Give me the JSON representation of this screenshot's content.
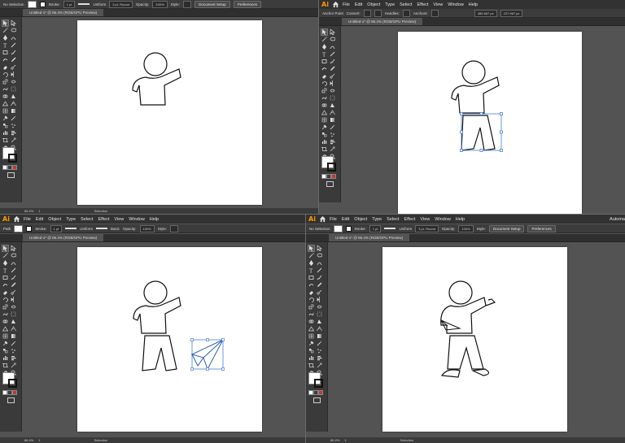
{
  "app": {
    "logo": "Ai"
  },
  "menu": [
    "File",
    "Edit",
    "Object",
    "Type",
    "Select",
    "Effect",
    "View",
    "Window",
    "Help"
  ],
  "right_edge_label": "Automa",
  "panes": [
    {
      "id": "tl",
      "control": {
        "selection_label": "No Selection",
        "stroke_label": "Stroke:",
        "stroke_weight": "1 pt",
        "profile_label": "Uniform",
        "brush_label": "3 pt. Round",
        "opacity_label": "Opacity:",
        "opacity_value": "100%",
        "style_label": "Style:",
        "doc_setup": "Document Setup",
        "preferences": "Preferences"
      },
      "tab_title": "Untitled-1* @ 86.4% (RGB/GPU Preview)",
      "status": {
        "zoom": "86.4%",
        "page": "1",
        "tool": "Selection"
      }
    },
    {
      "id": "tr",
      "control": {
        "selection_label": "Anchor Point",
        "convert_label": "Convert:",
        "handles_label": "Handles:",
        "anchors_label": "Anchors:",
        "x_value": "389.667 px",
        "y_value": "227.967 px"
      },
      "tab_title": "Untitled-1* @ 86.4% (RGB/GPU Preview)",
      "status": {
        "zoom": "",
        "page": "",
        "tool": ""
      }
    },
    {
      "id": "bl",
      "control": {
        "selection_label": "Path",
        "stroke_label": "Stroke:",
        "stroke_weight": "1 pt",
        "profile_label": "Uniform",
        "brush_label": "Basic",
        "opacity_label": "Opacity:",
        "opacity_value": "100%",
        "style_label": "Style:"
      },
      "tab_title": "Untitled-1* @ 86.4% (RGB/GPU Preview)",
      "status": {
        "zoom": "86.4%",
        "page": "1",
        "tool": "Selection"
      }
    },
    {
      "id": "br",
      "control": {
        "selection_label": "No Selection",
        "stroke_label": "Stroke:",
        "stroke_weight": "1 pt",
        "profile_label": "Uniform",
        "brush_label": "3 pt. Round",
        "opacity_label": "Opacity:",
        "opacity_value": "100%",
        "style_label": "Style:",
        "doc_setup": "Document Setup",
        "preferences": "Preferences"
      },
      "tab_title": "Untitled-1* @ 86.4% (RGB/GPU Preview)",
      "status": {
        "zoom": "86.4%",
        "page": "1",
        "tool": "Selection"
      }
    }
  ],
  "colors": {
    "workspace": "#535353",
    "menubar": "#323232",
    "controlbar": "#3c3c3c",
    "toolbox": "#3a3a3a",
    "accent_logo": "#ff9a00",
    "selection_blue": "#4a7fd4",
    "artwork_stroke": "#111111"
  },
  "icons": [
    "home-icon",
    "selection-tool-icon",
    "direct-selection-tool-icon",
    "pen-tool-icon",
    "type-tool-icon",
    "line-tool-icon",
    "rectangle-tool-icon",
    "paintbrush-tool-icon",
    "pencil-tool-icon",
    "eraser-tool-icon",
    "rotate-tool-icon",
    "scale-tool-icon",
    "width-tool-icon",
    "free-transform-tool-icon",
    "shape-builder-tool-icon",
    "perspective-tool-icon",
    "mesh-tool-icon",
    "gradient-tool-icon",
    "eyedropper-tool-icon",
    "blend-tool-icon",
    "symbol-sprayer-tool-icon",
    "graph-tool-icon",
    "artboard-tool-icon",
    "slice-tool-icon",
    "hand-tool-icon",
    "zoom-tool-icon",
    "fill-swatch",
    "stroke-swatch",
    "paper-plane-icon"
  ]
}
